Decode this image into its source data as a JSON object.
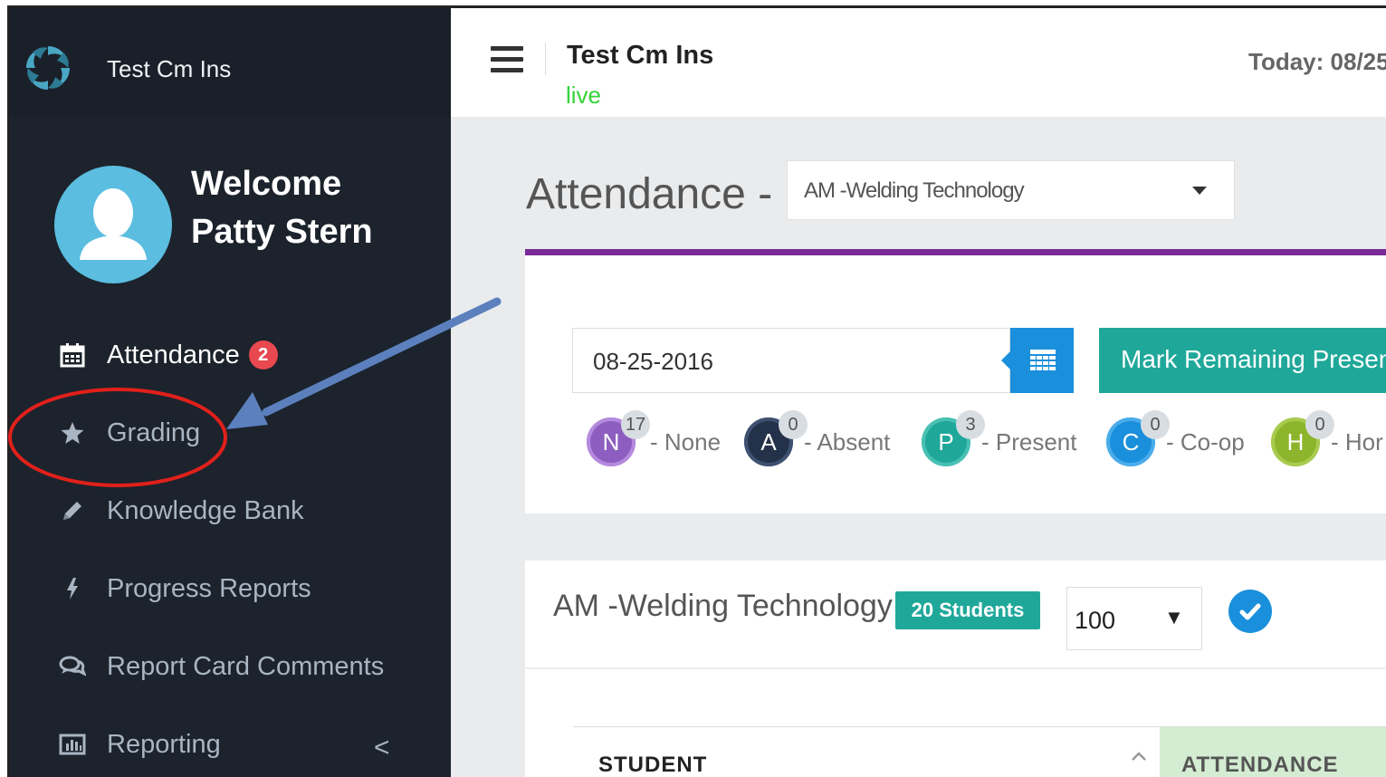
{
  "sidebar": {
    "brand": "Test Cm Ins",
    "welcome_line1": "Welcome",
    "welcome_line2": "Patty Stern",
    "items": [
      {
        "label": "Attendance",
        "icon": "calendar-icon",
        "badge": "2",
        "active": true
      },
      {
        "label": "Grading",
        "icon": "star-icon"
      },
      {
        "label": "Knowledge Bank",
        "icon": "pencil-icon"
      },
      {
        "label": "Progress Reports",
        "icon": "bolt-icon"
      },
      {
        "label": "Report Card Comments",
        "icon": "comments-icon"
      },
      {
        "label": "Reporting",
        "icon": "bar-chart-icon",
        "chevron": "<"
      }
    ]
  },
  "header": {
    "title": "Test Cm Ins",
    "status": "live",
    "today": "Today: 08/25"
  },
  "main": {
    "page_title": "Attendance -",
    "class_select": "AM -Welding Technology",
    "date": "08-25-2016",
    "mark_button": "Mark Remaining Present",
    "legend": [
      {
        "letter": "N",
        "count": "17",
        "label": "- None",
        "color": "#8d5ebf"
      },
      {
        "letter": "A",
        "count": "0",
        "label": "- Absent",
        "color": "#233249"
      },
      {
        "letter": "P",
        "count": "3",
        "label": "- Present",
        "color": "#1fa89a"
      },
      {
        "letter": "C",
        "count": "0",
        "label": "- Co-op",
        "color": "#1a8fdc"
      },
      {
        "letter": "H",
        "count": "0",
        "label": "- Hor",
        "color": "#8db52b"
      }
    ],
    "class_panel": {
      "title": "AM -Welding Technology",
      "students_badge": "20 Students",
      "per_page": "100",
      "per_page_arrow": "▼"
    },
    "table": {
      "columns": [
        "STUDENT",
        "ATTENDANCE"
      ]
    }
  },
  "annotation": {
    "arrow_color": "#5b80bd",
    "circle_color": "#e0201b"
  }
}
